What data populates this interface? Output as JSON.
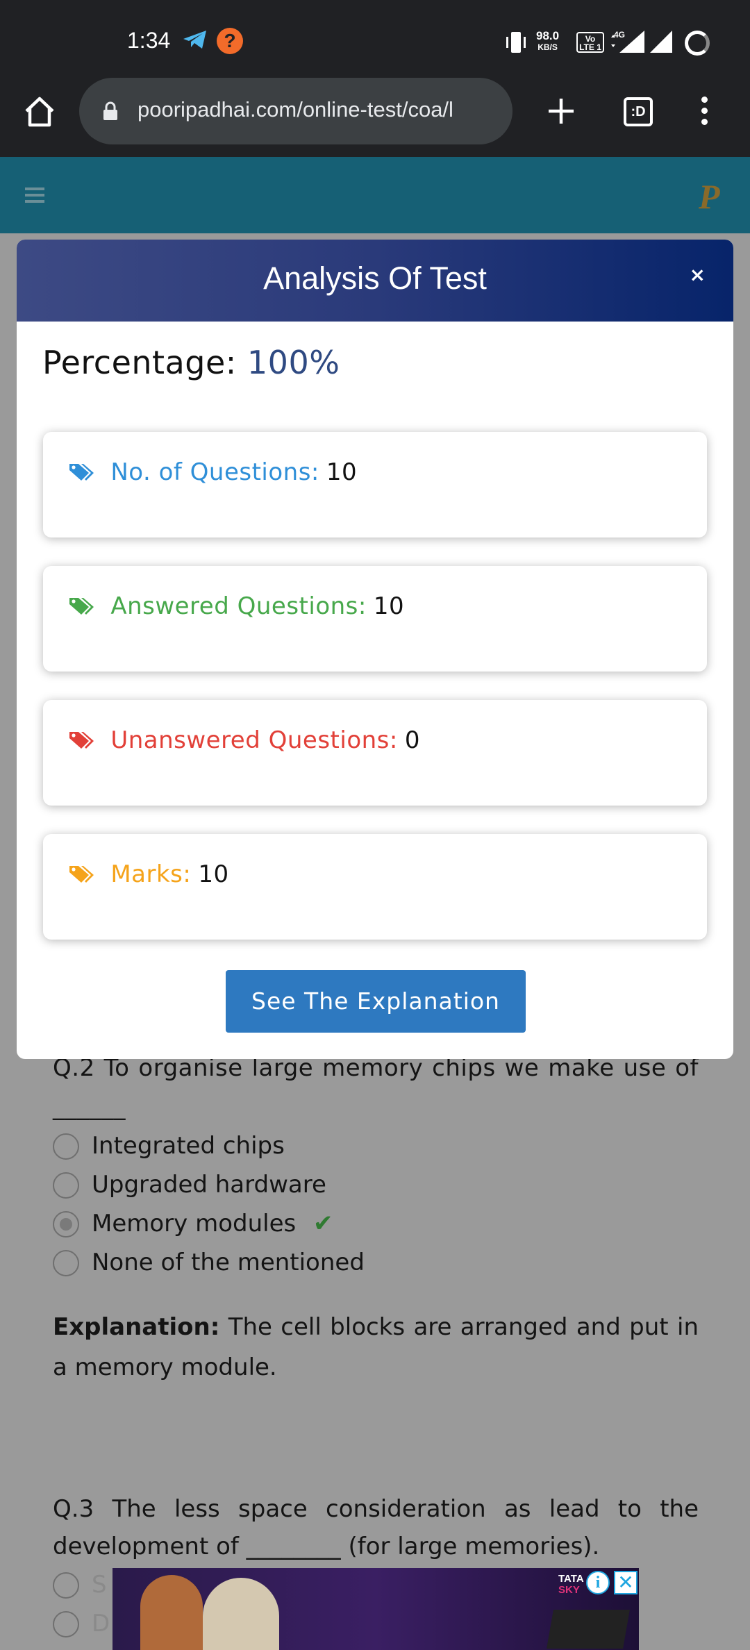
{
  "status_bar": {
    "time": "1:34",
    "net_speed_value": "98.0",
    "net_speed_unit": "KB/S",
    "volte_label": "Vo LTE 1",
    "network_type": "4G"
  },
  "browser": {
    "url": "pooripadhai.com/online-test/coa/l",
    "tabs_label": ":D"
  },
  "modal": {
    "title": "Analysis Of Test",
    "close_label": "×",
    "percentage_label": "Percentage:",
    "percentage_value": "100%",
    "stats": [
      {
        "label": "No. of Questions:",
        "value": "10",
        "color": "#2f8fd8"
      },
      {
        "label": "Answered Questions:",
        "value": "10",
        "color": "#47a84b"
      },
      {
        "label": "Unanswered Questions:",
        "value": "0",
        "color": "#e24038"
      },
      {
        "label": "Marks:",
        "value": "10",
        "color": "#f5a31a"
      }
    ],
    "explain_button": "See The Explanation"
  },
  "background": {
    "q2_text": "Q.2 To organise large memory chips we make use of ______",
    "q2_options": [
      "Integrated chips",
      "Upgraded hardware",
      "Memory modules",
      "None of the mentioned"
    ],
    "q2_selected_index": 2,
    "check_glyph": "✔",
    "explanation_label": "Explanation:",
    "explanation_text": "The cell blocks are arranged and put in a memory module.",
    "q3_text": "Q.3 The less space consideration as lead to the development of ________ (for large memories).",
    "q3_options": [
      "S",
      "D"
    ]
  },
  "ad": {
    "brand": "TATA",
    "brand_sub": "SKY",
    "info_label": "i",
    "close_label": "✕"
  }
}
